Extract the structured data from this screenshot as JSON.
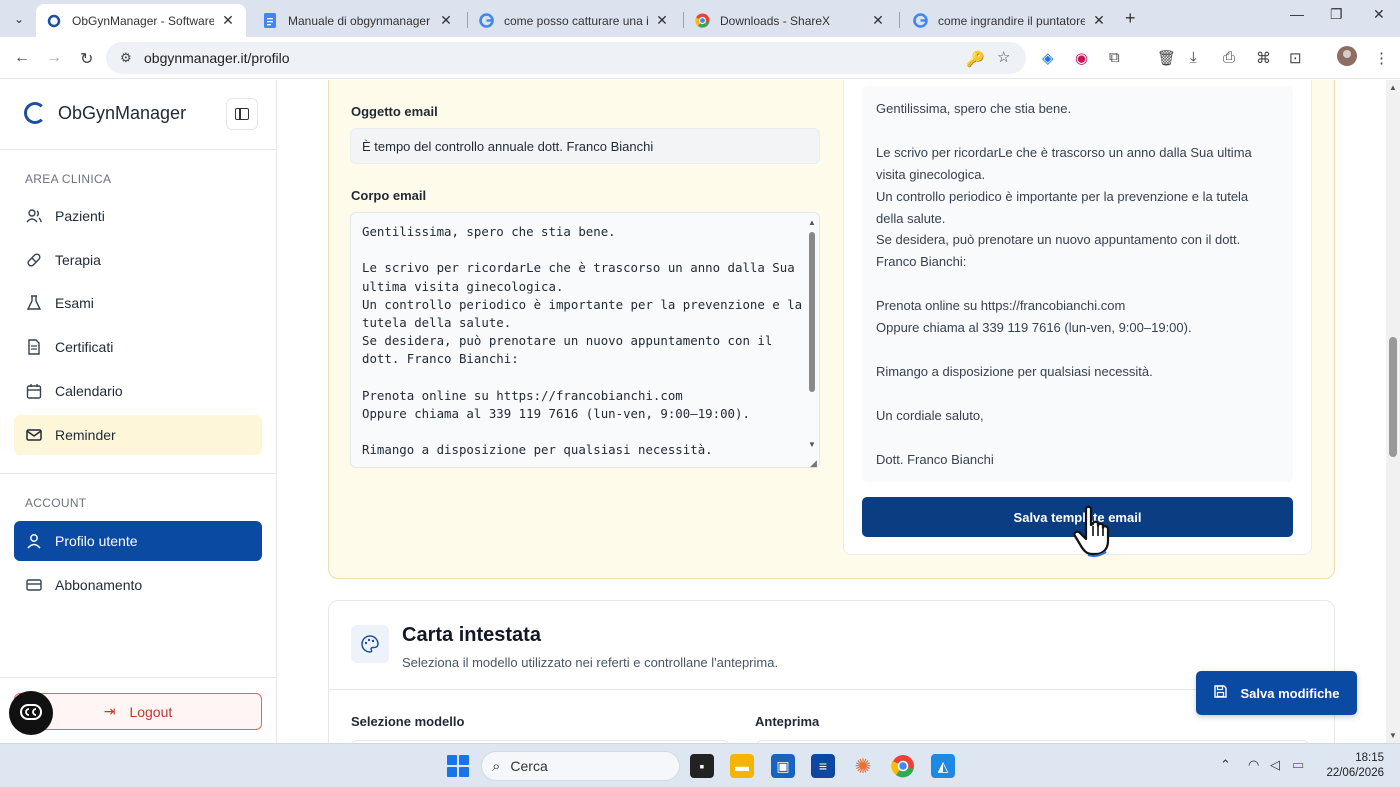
{
  "browser": {
    "tabs": [
      {
        "title": "ObGynManager - Software Ges",
        "active": true
      },
      {
        "title": "Manuale di obgynmanager - D",
        "active": false
      },
      {
        "title": "come posso catturare una inter",
        "active": false
      },
      {
        "title": "Downloads - ShareX",
        "active": false
      },
      {
        "title": "come ingrandire il puntatore de",
        "active": false
      }
    ],
    "url": "obgynmanager.it/profilo"
  },
  "sidebar": {
    "brand": "ObGynManager",
    "section_clinical": "AREA CLINICA",
    "clinical_items": [
      {
        "label": "Pazienti",
        "icon": "users-icon"
      },
      {
        "label": "Terapia",
        "icon": "pill-icon"
      },
      {
        "label": "Esami",
        "icon": "flask-icon"
      },
      {
        "label": "Certificati",
        "icon": "document-icon"
      },
      {
        "label": "Calendario",
        "icon": "calendar-icon"
      },
      {
        "label": "Reminder",
        "icon": "mail-icon"
      }
    ],
    "section_account": "ACCOUNT",
    "account_items": [
      {
        "label": "Profilo utente",
        "icon": "user-icon"
      },
      {
        "label": "Abbonamento",
        "icon": "card-icon"
      }
    ],
    "logout": "Logout"
  },
  "email_template": {
    "subject_label": "Oggetto email",
    "subject_value": "È tempo del controllo annuale dott. Franco Bianchi",
    "body_label": "Corpo email",
    "body_value": "Gentilissima, spero che stia bene.\n\nLe scrivo per ricordarLe che è trascorso un anno dalla Sua ultima visita ginecologica.\nUn controllo periodico è importante per la prevenzione e la tutela della salute.\nSe desidera, può prenotare un nuovo appuntamento con il dott. Franco Bianchi:\n\nPrenota online su https://francobianchi.com\nOppure chiama al 339 119 7616 (lun-ven, 9:00–19:00).\n\nRimango a disposizione per qualsiasi necessità.",
    "preview_text": "Gentilissima, spero che stia bene.\n\nLe scrivo per ricordarLe che è trascorso un anno dalla Sua ultima visita ginecologica.\nUn controllo periodico è importante per la prevenzione e la tutela della salute.\nSe desidera, può prenotare un nuovo appuntamento con il dott. Franco Bianchi:\n\nPrenota online su https://francobianchi.com\nOppure chiama al 339 119 7616 (lun-ven, 9:00–19:00).\n\nRimango a disposizione per qualsiasi necessità.\n\nUn cordiale saluto,\n\nDott. Franco Bianchi",
    "save_button": "Salva template email"
  },
  "letterhead": {
    "title": "Carta intestata",
    "subtitle": "Seleziona il modello utilizzato nei referti e controllane l'anteprima.",
    "model_label": "Selezione modello",
    "preview_label": "Anteprima"
  },
  "save_changes_button": "Salva modifiche",
  "taskbar": {
    "search_placeholder": "Cerca",
    "time": "18:15",
    "date": "22/06/2026"
  },
  "colors": {
    "primary": "#0b4aa2",
    "accent_dark": "#0b3d82",
    "highlight": "#fdf6d8",
    "card_bg": "#fffbea",
    "danger": "#c0392b"
  }
}
